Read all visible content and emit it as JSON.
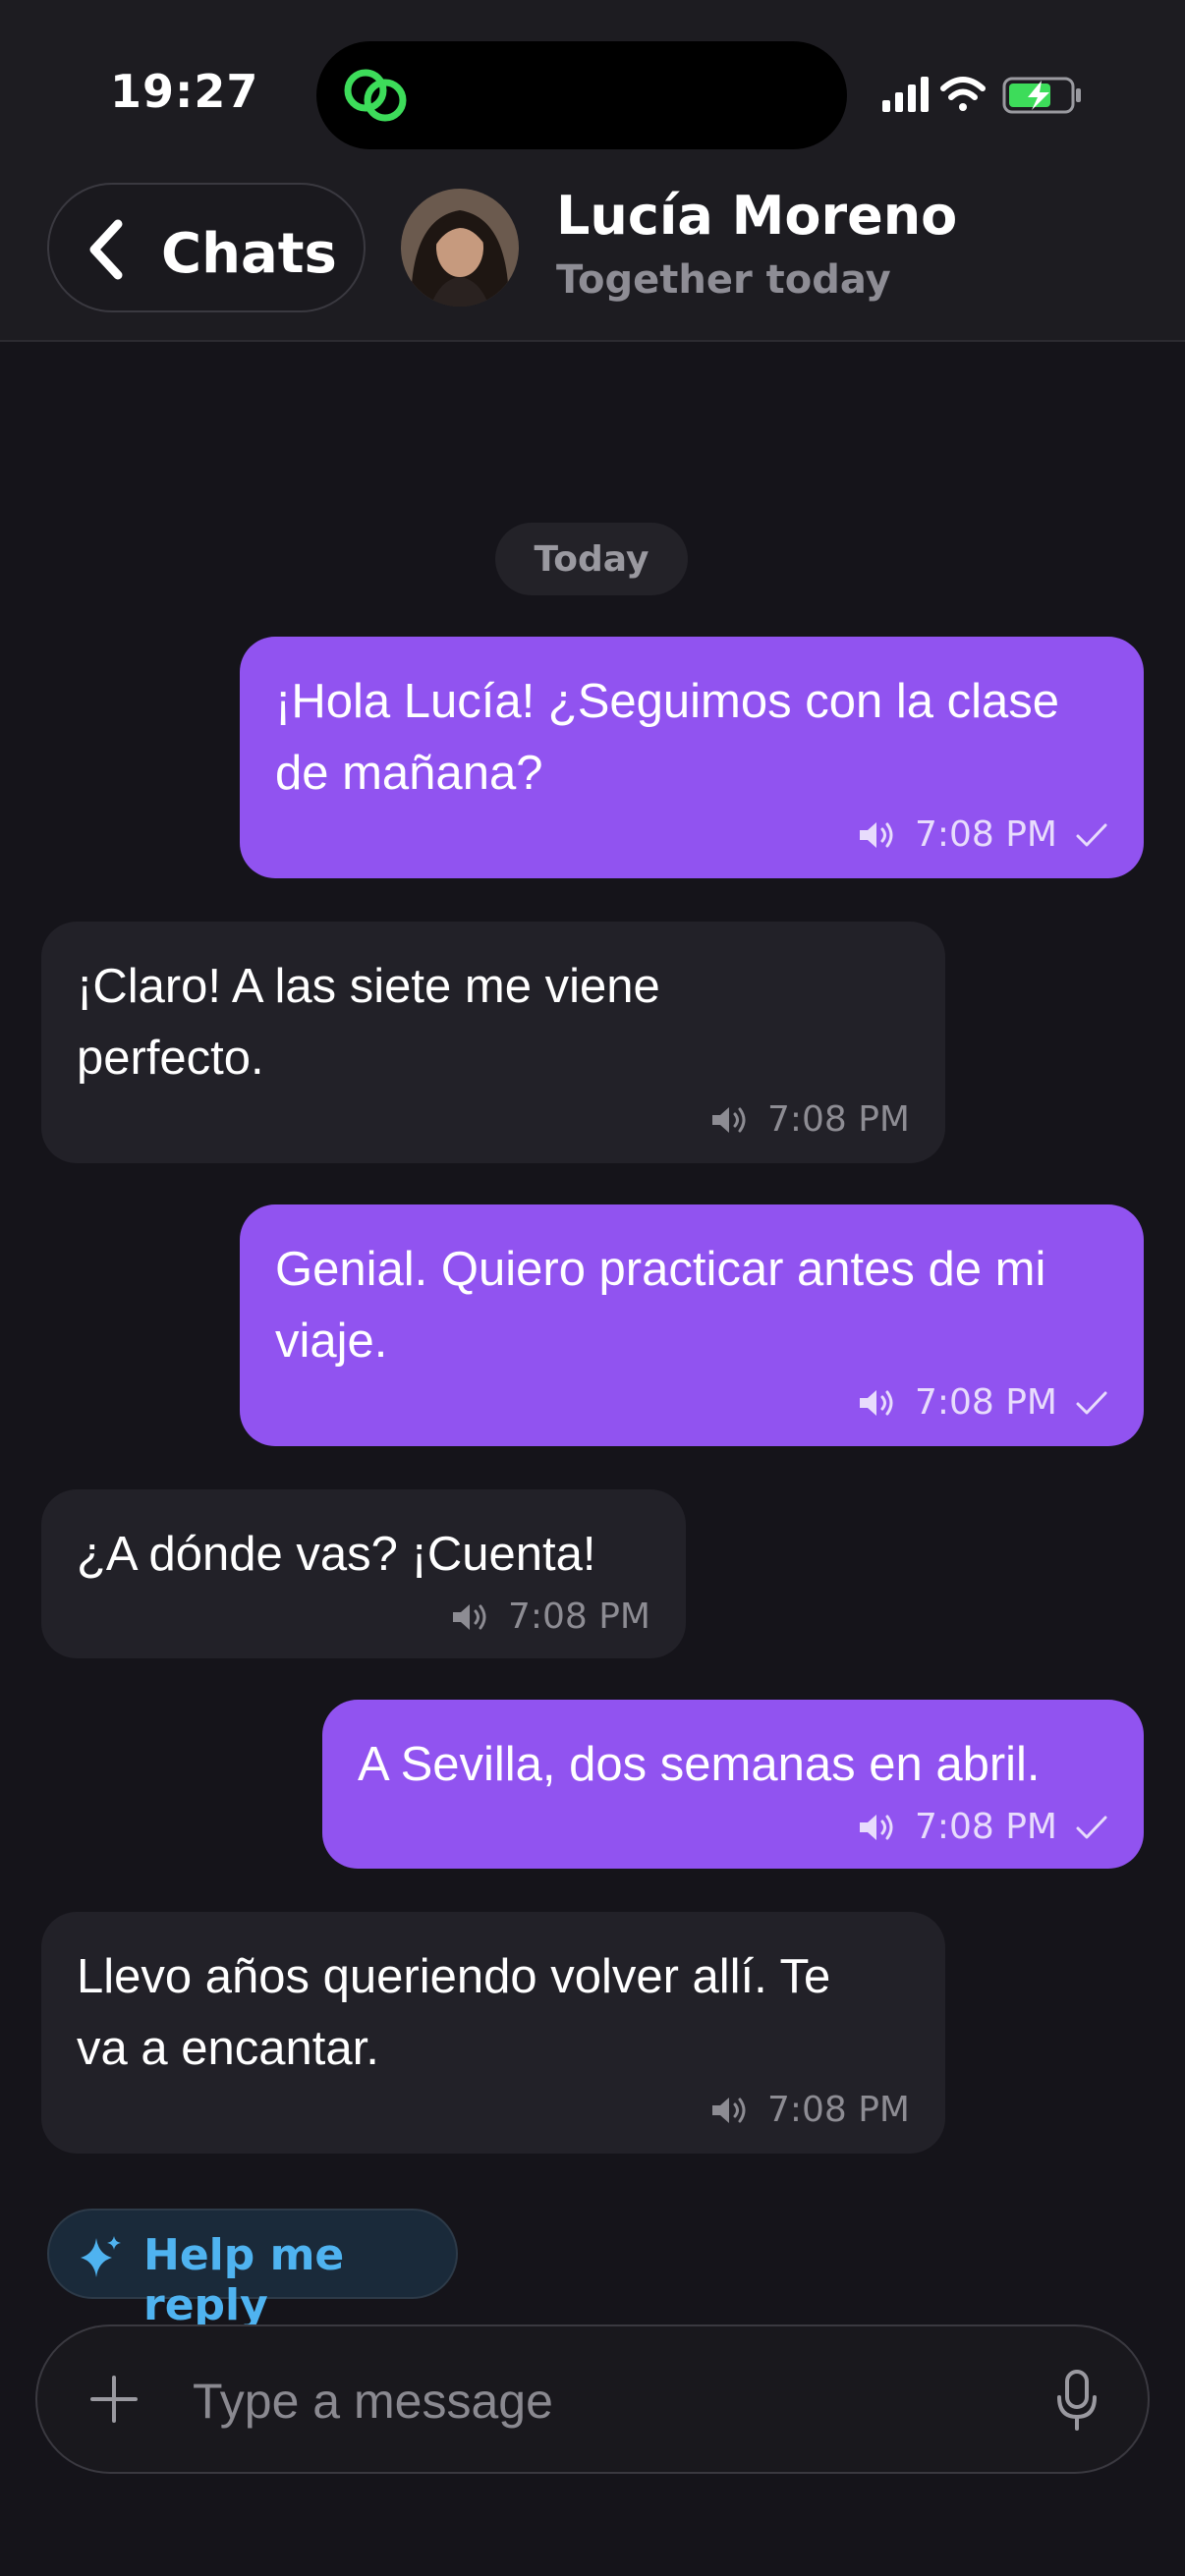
{
  "status_bar": {
    "time": "19:27"
  },
  "header": {
    "back_label": "Chats",
    "contact_name": "Lucía Moreno",
    "contact_status": "Together today"
  },
  "date_divider": "Today",
  "messages": [
    {
      "direction": "out",
      "text": "¡Hola Lucía! ¿Seguimos con la clase de mañana?",
      "time": "7:08 PM"
    },
    {
      "direction": "in",
      "text": "¡Claro! A las siete me viene perfecto.",
      "time": "7:08 PM"
    },
    {
      "direction": "out",
      "text": "Genial. Quiero practicar antes de mi viaje.",
      "time": "7:08 PM"
    },
    {
      "direction": "in",
      "text": "¿A dónde vas? ¡Cuenta!",
      "time": "7:08 PM"
    },
    {
      "direction": "out",
      "text": "A Sevilla, dos semanas en abril.",
      "time": "7:08 PM"
    },
    {
      "direction": "in",
      "text": "Llevo años queriendo volver allí. Te va a encantar.",
      "time": "7:08 PM"
    }
  ],
  "help_reply": {
    "label": "Help me reply"
  },
  "composer": {
    "placeholder": "Type a message",
    "value": ""
  },
  "colors": {
    "outgoing_bubble": "#9153f0",
    "incoming_bubble": "#222128",
    "accent_blue": "#4fb3f0",
    "app_icon_green": "#3ddc5a"
  }
}
